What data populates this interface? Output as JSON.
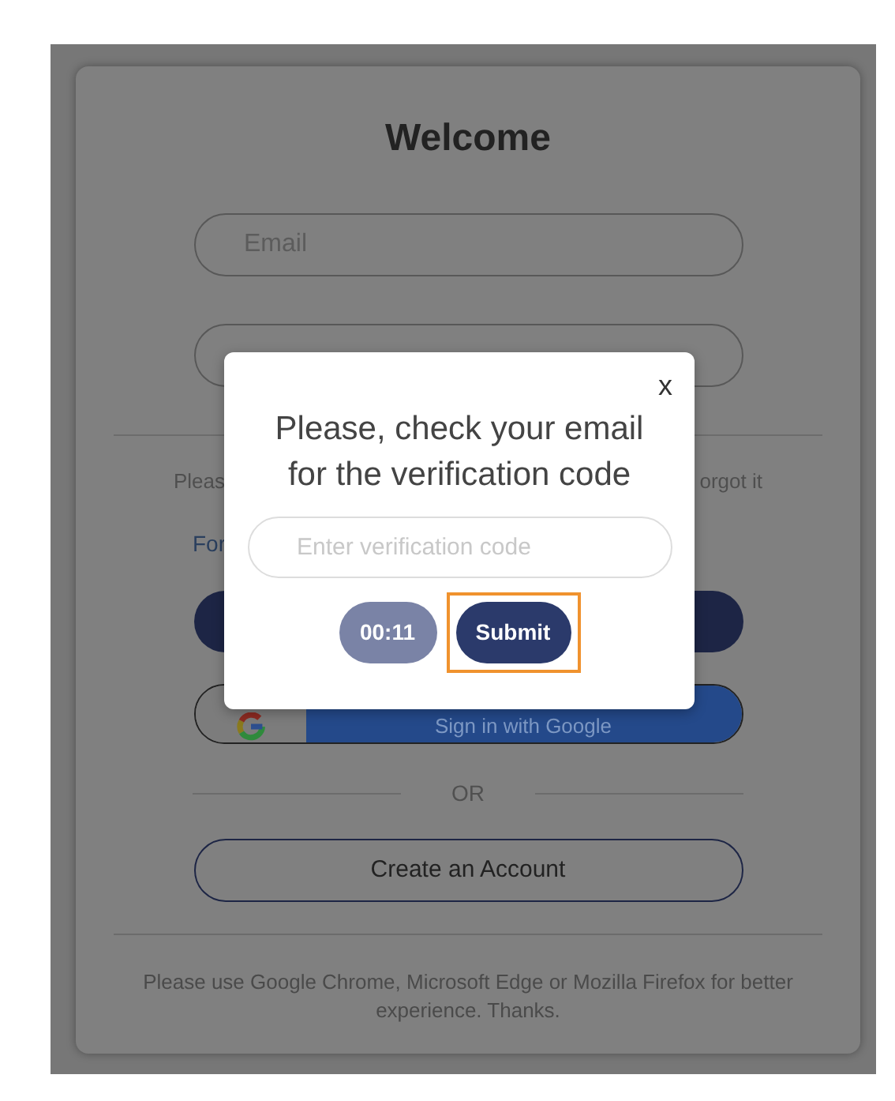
{
  "background": {
    "title": "Welcome",
    "email_field": {
      "placeholder": "Email"
    },
    "notice_fragments": [
      "Pleas",
      "orgot it"
    ],
    "link_fragment": "For",
    "google_button": {
      "label": "Sign in with Google"
    },
    "separator": "OR",
    "create_account_button": {
      "label": "Create an Account"
    },
    "footer": "Please use Google Chrome, Microsoft Edge or Mozilla Firefox for better experience. Thanks."
  },
  "dialog": {
    "close": "x",
    "message": "Please, check your email for the verification code",
    "code_field": {
      "placeholder": "Enter verification code"
    },
    "timer_button": {
      "label": "00:11",
      "disabled": true
    },
    "submit_button": {
      "label": "Submit",
      "highlighted": true
    }
  }
}
